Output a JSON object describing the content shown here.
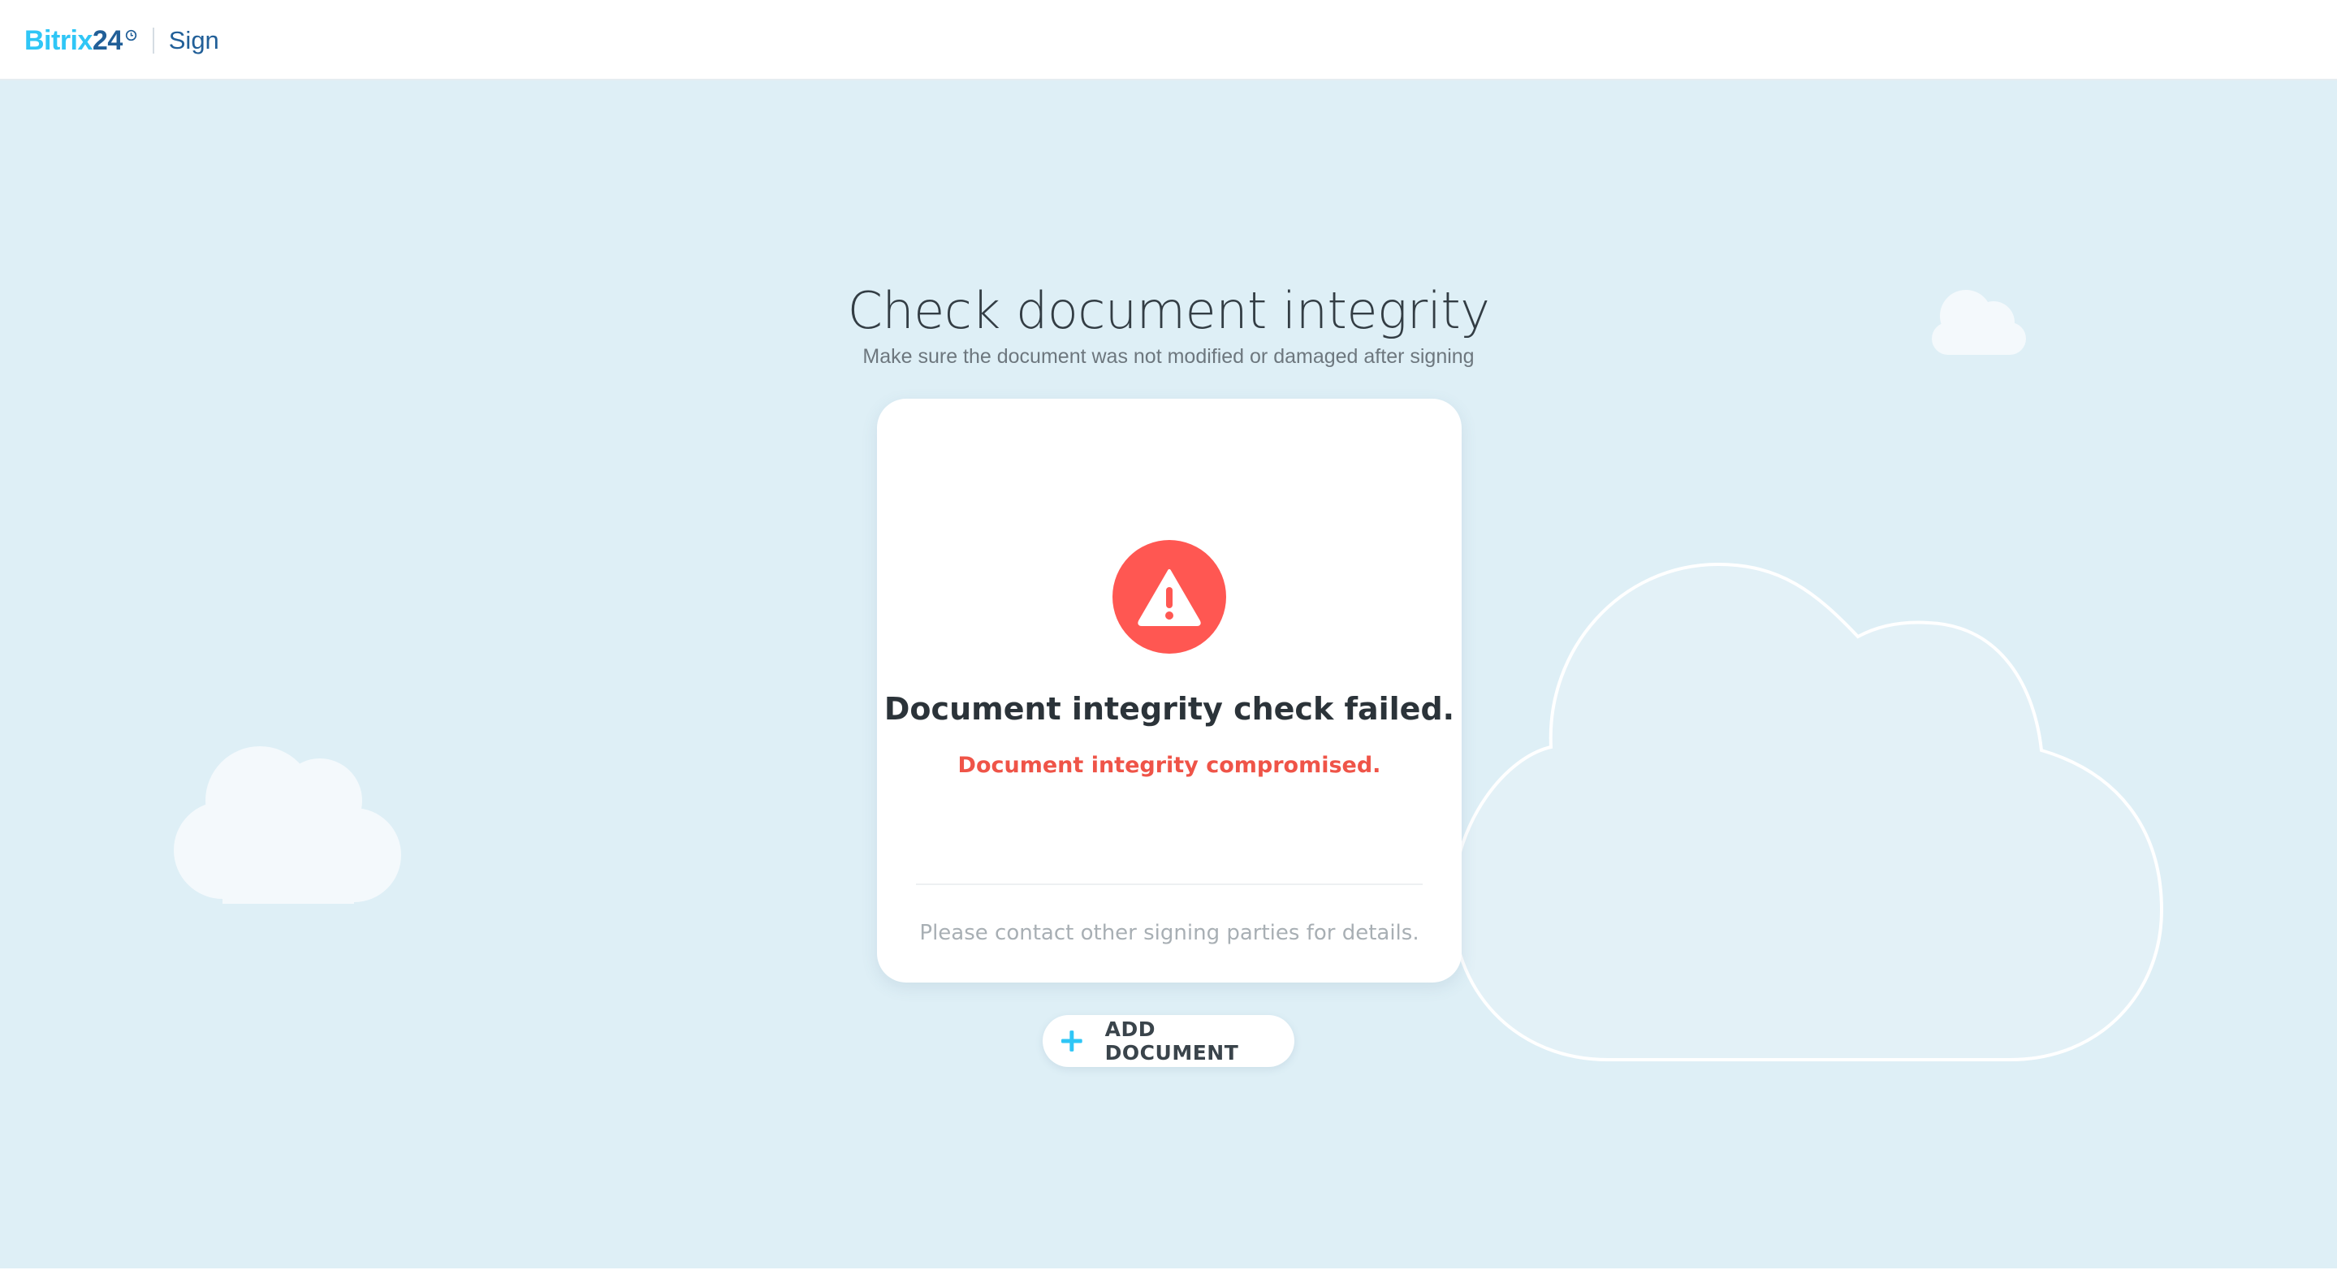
{
  "header": {
    "logo_bitrix": "Bitrix",
    "logo_24": "24",
    "product": "Sign"
  },
  "page": {
    "title": "Check document integrity",
    "subtitle": "Make sure the document was not modified or damaged after signing"
  },
  "result": {
    "icon": "warning-triangle-icon",
    "title": "Document integrity check failed.",
    "reason": "Document integrity compromised.",
    "footer": "Please contact other signing parties for details."
  },
  "actions": {
    "add_document_label": "ADD DOCUMENT"
  },
  "colors": {
    "background": "#deeff6",
    "logo_light": "#2fc6f6",
    "logo_dark": "#215f98",
    "error": "#ff5752",
    "error_text": "#ef5448",
    "accent_plus": "#2fc6f6"
  }
}
